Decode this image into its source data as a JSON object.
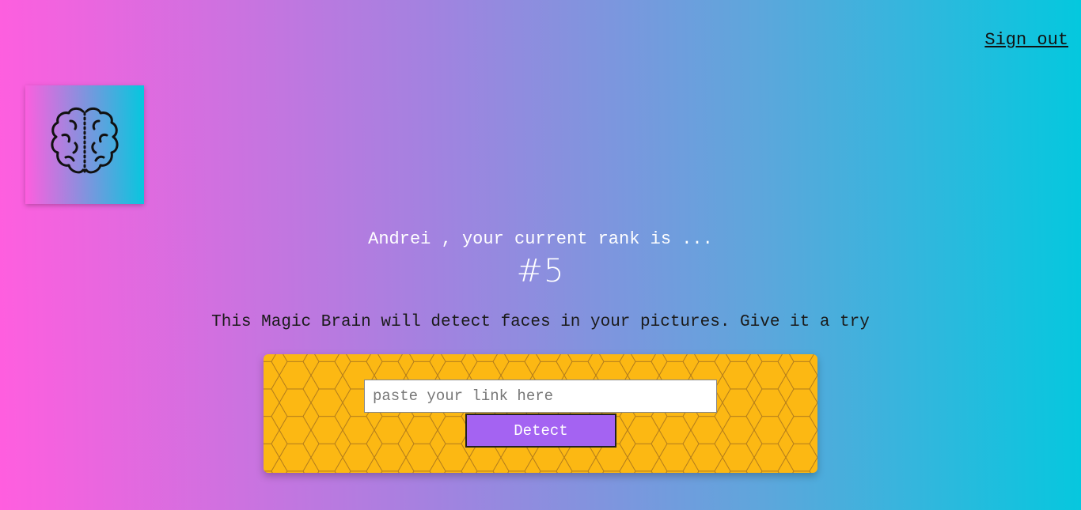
{
  "nav": {
    "signout_label": "Sign out"
  },
  "logo": {
    "icon": "brain-icon"
  },
  "rank": {
    "user_name": "Andrei",
    "line": "Andrei , your current rank is ...",
    "number": "#5"
  },
  "intro": {
    "text": "This Magic Brain will detect faces in your pictures. Give it a try"
  },
  "form": {
    "input_value": "",
    "input_placeholder": "paste your link here",
    "button_label": "Detect"
  },
  "colors": {
    "gradient_start": "#ff5edf",
    "gradient_end": "#04c8de",
    "panel_bg": "#fcb813",
    "button_bg": "#a463f2"
  }
}
